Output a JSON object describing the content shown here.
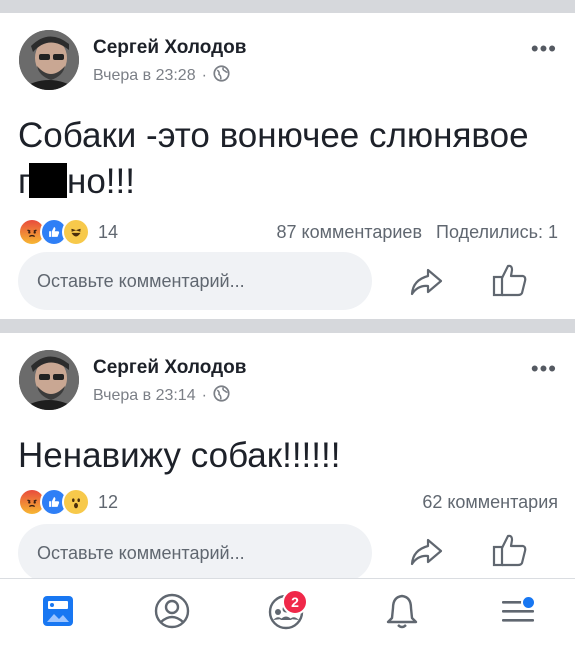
{
  "posts": [
    {
      "author": "Сергей Холодов",
      "time": "Вчера в 23:28",
      "separator": "·",
      "privacy_icon": "globe-icon",
      "text_before": "Собаки -это вонючее слюнявое",
      "text_line2_start": "г",
      "text_line2_end": "но!!!",
      "reactions": [
        "angry",
        "like",
        "haha"
      ],
      "reaction_count": "14",
      "comments": "87 комментариев",
      "shares": "Поделились: 1",
      "comment_placeholder": "Оставьте комментарий..."
    },
    {
      "author": "Сергей Холодов",
      "time": "Вчера в 23:14",
      "separator": "·",
      "privacy_icon": "globe-icon",
      "text": "Ненавижу собак!!!!!!",
      "reactions": [
        "angry",
        "like",
        "wow"
      ],
      "reaction_count": "12",
      "comments": "62 комментария",
      "comment_placeholder": "Оставьте комментарий..."
    }
  ],
  "more_label": "•••",
  "tabbar": {
    "items": [
      "news-feed",
      "profile",
      "groups",
      "notifications",
      "menu"
    ],
    "groups_badge": "2"
  },
  "colors": {
    "accent": "#1877f2",
    "badge": "#f02849",
    "background": "#ffffff",
    "separator": "#d6d8dc",
    "meta_text": "#7b7f86"
  }
}
